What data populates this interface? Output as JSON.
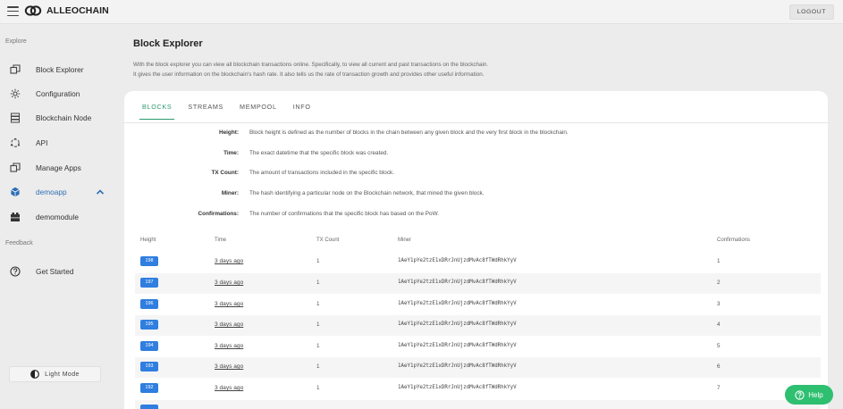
{
  "header": {
    "brand": "ALLEOCHAIN",
    "logout_label": "LOGOUT"
  },
  "sidebar": {
    "explore_label": "Explore",
    "feedback_label": "Feedback",
    "items": [
      {
        "label": "Block Explorer",
        "icon": "cube-outline-icon"
      },
      {
        "label": "Configuration",
        "icon": "gear-icon"
      },
      {
        "label": "Blockchain Node",
        "icon": "server-icon"
      },
      {
        "label": "API",
        "icon": "api-icon"
      },
      {
        "label": "Manage Apps",
        "icon": "cube-outline-icon"
      },
      {
        "label": "demoapp",
        "icon": "cube-filled-icon",
        "active": true
      },
      {
        "label": "demomodule",
        "icon": "module-icon"
      }
    ],
    "feedback_items": [
      {
        "label": "Get Started",
        "icon": "question-circle-icon"
      }
    ],
    "light_mode_label": "Light Mode"
  },
  "main": {
    "title": "Block Explorer",
    "description_line1": "With the block explorer you can view all blockchain transactions online. Specifically, to view all current and past transactions on the blockchain.",
    "description_line2": "It gives the user information on the blockchain's hash rate. It also tells us the rate of transaction growth and provides other useful information.",
    "tabs": [
      "BLOCKS",
      "STREAMS",
      "MEMPOOL",
      "INFO"
    ],
    "active_tab": "BLOCKS",
    "definitions": [
      {
        "term": "Height:",
        "desc": "Block height is defined as the number of blocks in the chain between any given block and the very first block in the blockchain."
      },
      {
        "term": "Time:",
        "desc": "The exact datetime that the specific block was created."
      },
      {
        "term": "TX Count:",
        "desc": "The amount of transactions included in the specific block."
      },
      {
        "term": "Miner:",
        "desc": "The hash identifying a particular node on the Blockchain network, that mined the given block."
      },
      {
        "term": "Confirmations:",
        "desc": "The number of confirmations that the specific block has based on the PoW."
      }
    ],
    "table": {
      "headers": [
        "Height",
        "Time",
        "TX Count",
        "Miner",
        "Confirmations"
      ],
      "rows": [
        {
          "height": "198",
          "time": "3 days ago",
          "tx": "1",
          "miner": "1AeY1pYe2tzE1xDRrJnUjzdMvAc8fTWdRhkYyV",
          "conf": "1"
        },
        {
          "height": "197",
          "time": "3 days ago",
          "tx": "1",
          "miner": "1AeY1pYe2tzE1xDRrJnUjzdMvAc8fTWdRhkYyV",
          "conf": "2"
        },
        {
          "height": "196",
          "time": "3 days ago",
          "tx": "1",
          "miner": "1AeY1pYe2tzE1xDRrJnUjzdMvAc8fTWdRhkYyV",
          "conf": "3"
        },
        {
          "height": "195",
          "time": "3 days ago",
          "tx": "1",
          "miner": "1AeY1pYe2tzE1xDRrJnUjzdMvAc8fTWdRhkYyV",
          "conf": "4"
        },
        {
          "height": "194",
          "time": "3 days ago",
          "tx": "1",
          "miner": "1AeY1pYe2tzE1xDRrJnUjzdMvAc8fTWdRhkYyV",
          "conf": "5"
        },
        {
          "height": "193",
          "time": "3 days ago",
          "tx": "1",
          "miner": "1AeY1pYe2tzE1xDRrJnUjzdMvAc8fTWdRhkYyV",
          "conf": "6"
        },
        {
          "height": "192",
          "time": "3 days ago",
          "tx": "1",
          "miner": "1AeY1pYe2tzE1xDRrJnUjzdMvAc8fTWdRhkYyV",
          "conf": "7"
        }
      ]
    }
  },
  "help": {
    "label": "Help"
  },
  "colors": {
    "badge": "#2f7ee0",
    "tab_active": "#2b9a6e",
    "help": "#2fbf71",
    "active_nav": "#2f6fb3"
  }
}
